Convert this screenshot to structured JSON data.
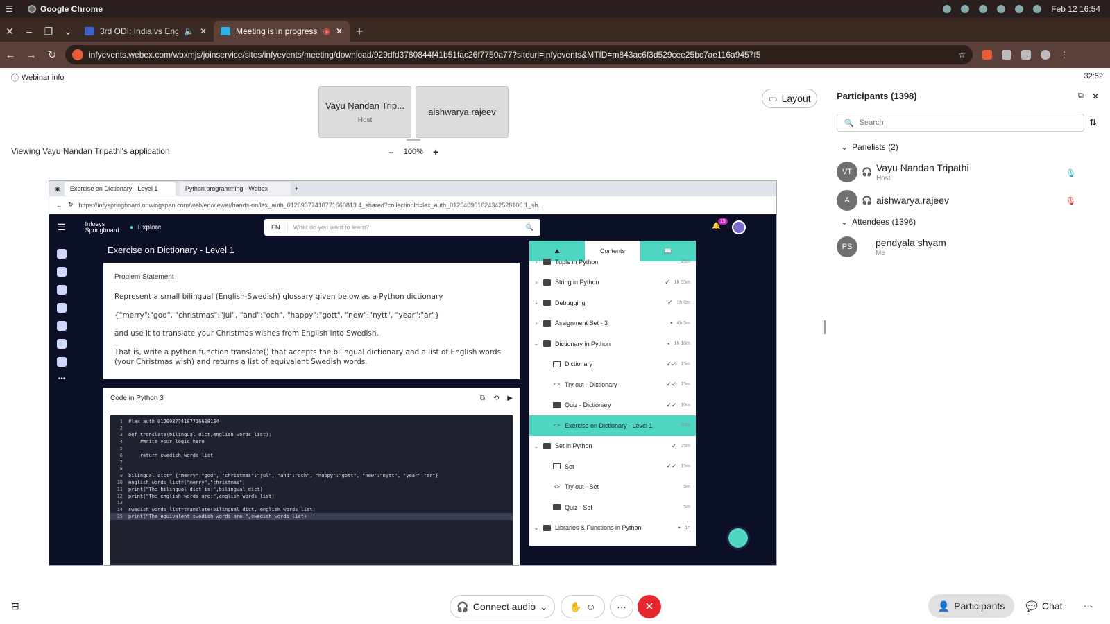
{
  "os": {
    "app_name": "Google Chrome",
    "datetime": "Feb 12  16:54"
  },
  "browser": {
    "tabs": [
      {
        "label": "3rd ODI: India vs Engla"
      },
      {
        "label": "Meeting is in progress..."
      }
    ],
    "url": "infyevents.webex.com/wbxmjs/joinservice/sites/infyevents/meeting/download/929dfd3780844f41b51fac26f7750a77?siteurl=infyevents&MTID=m843ac6f3d529cee25bc7ae116a9457f5"
  },
  "meeting": {
    "webinar_info": "Webinar info",
    "timer": "32:52",
    "tiles": [
      {
        "name": "Vayu Nandan Trip...",
        "role": "Host"
      },
      {
        "name": "aishwarya.rajeev"
      }
    ],
    "layout_label": "Layout",
    "viewing_text": "Viewing Vayu Nandan Tripathi's application",
    "zoom_level": "100%",
    "zoom_minus": "–",
    "zoom_plus": "+"
  },
  "shared": {
    "edge_tabs": [
      "Exercise on Dictionary - Level 1",
      "Python programming - Webex"
    ],
    "edge_url": "https://infyspringboard.onwingspan.com/web/en/viewer/hands-on/lex_auth_01269377418771660813 4_shared?collectionId=lex_auth_012540961624342528106 1_sh...",
    "logo": "Infosys Springboard",
    "explore": "Explore",
    "lang": "EN",
    "search_placeholder": "What do you want to learn?",
    "notif_count": "15",
    "page_title": "Exercise on Dictionary - Level 1",
    "problem_heading": "Problem Statement",
    "problem_p1": "Represent a small bilingual (English-Swedish) glossary given below as a Python dictionary",
    "problem_p2": "{\"merry\":\"god\", \"christmas\":\"jul\", \"and\":\"och\", \"happy\":\"gott\", \"new\":\"nytt\", \"year\":\"ar\"}",
    "problem_p3": "and use it to translate your Christmas wishes from English into Swedish.",
    "problem_p4": "That is, write a python function translate() that accepts the bilingual dictionary and a list of English words (your Christmas wish) and returns a list of equivalent Swedish words.",
    "code_heading": "Code in Python 3",
    "code_lines": [
      {
        "n": "1",
        "t": "#lex_auth_012693774187716608134"
      },
      {
        "n": "2",
        "t": ""
      },
      {
        "n": "3",
        "t": "def translate(bilingual_dict,english_words_list):"
      },
      {
        "n": "4",
        "t": "    #Write your logic here"
      },
      {
        "n": "5",
        "t": ""
      },
      {
        "n": "6",
        "t": "    return swedish_words_list"
      },
      {
        "n": "7",
        "t": ""
      },
      {
        "n": "8",
        "t": ""
      },
      {
        "n": "9",
        "t": "bilingual_dict= {\"merry\":\"god\", \"christmas\":\"jul\", \"and\":\"och\", \"happy\":\"gott\", \"new\":\"nytt\", \"year\":\"ar\"}"
      },
      {
        "n": "10",
        "t": "english_words_list=[\"merry\",\"christmas\"]"
      },
      {
        "n": "11",
        "t": "print(\"The bilingual dict is:\",bilingual_dict)"
      },
      {
        "n": "12",
        "t": "print(\"The english words are:\",english_words_list)"
      },
      {
        "n": "13",
        "t": ""
      },
      {
        "n": "14",
        "t": "swedish_words_list=translate(bilingual_dict, english_words_list)"
      },
      {
        "n": "15",
        "t": "print(\"The equivalent swedish words are:\",swedish_words_list)"
      }
    ],
    "contents_tab": "Contents",
    "contents": [
      {
        "label": "Tuple in Python",
        "dur": "25m",
        "type": "folder",
        "chev": "›"
      },
      {
        "label": "String in Python",
        "dur": "1h 55m",
        "type": "folder",
        "chev": "›",
        "st": "✓"
      },
      {
        "label": "Debugging",
        "dur": "1h 8m",
        "type": "folder",
        "chev": "›",
        "st": "✓"
      },
      {
        "label": "Assignment Set - 3",
        "dur": "4h 5m",
        "type": "folder",
        "chev": "›",
        "st": "◔"
      },
      {
        "label": "Dictionary in Python",
        "dur": "1h 10m",
        "type": "folder",
        "chev": "⌄",
        "st": "◔"
      },
      {
        "label": "Dictionary",
        "dur": "15m",
        "type": "doc",
        "indent": true,
        "st": "✓✓"
      },
      {
        "label": "Try out - Dictionary",
        "dur": "15m",
        "type": "code",
        "indent": true,
        "st": "✓✓"
      },
      {
        "label": "Quiz - Dictionary",
        "dur": "10m",
        "type": "chk",
        "indent": true,
        "st": "✓✓"
      },
      {
        "label": "Exercise on Dictionary - Level 1",
        "dur": "30m",
        "type": "code",
        "indent": true,
        "sel": true
      },
      {
        "label": "Set in Python",
        "dur": "25m",
        "type": "folder",
        "chev": "⌄",
        "st": "✓"
      },
      {
        "label": "Set",
        "dur": "15m",
        "type": "doc",
        "indent": true,
        "st": "✓✓"
      },
      {
        "label": "Try out - Set",
        "dur": "5m",
        "type": "code",
        "indent": true
      },
      {
        "label": "Quiz - Set",
        "dur": "5m",
        "type": "chk",
        "indent": true
      },
      {
        "label": "Libraries & Functions in Python",
        "dur": "1h",
        "type": "folder",
        "chev": "⌄",
        "st": "◔"
      }
    ]
  },
  "participants": {
    "title": "Participants (1398)",
    "search_placeholder": "Search",
    "panelists_label": "Panelists (2)",
    "panelists": [
      {
        "initials": "VT",
        "name": "Vayu Nandan Tripathi",
        "role": "Host"
      },
      {
        "initials": "A",
        "name": "aishwarya.rajeev",
        "role": ""
      }
    ],
    "attendees_label": "Attendees (1396)",
    "attendees": [
      {
        "initials": "PS",
        "name": "pendyala shyam",
        "role": "Me"
      }
    ]
  },
  "controls": {
    "connect_audio": "Connect audio",
    "more": "···",
    "participants": "Participants",
    "chat": "Chat"
  },
  "colors": {
    "accent": "#4fd6c2",
    "end_call": "#e5262d",
    "springboard_bg": "#0b1026"
  }
}
